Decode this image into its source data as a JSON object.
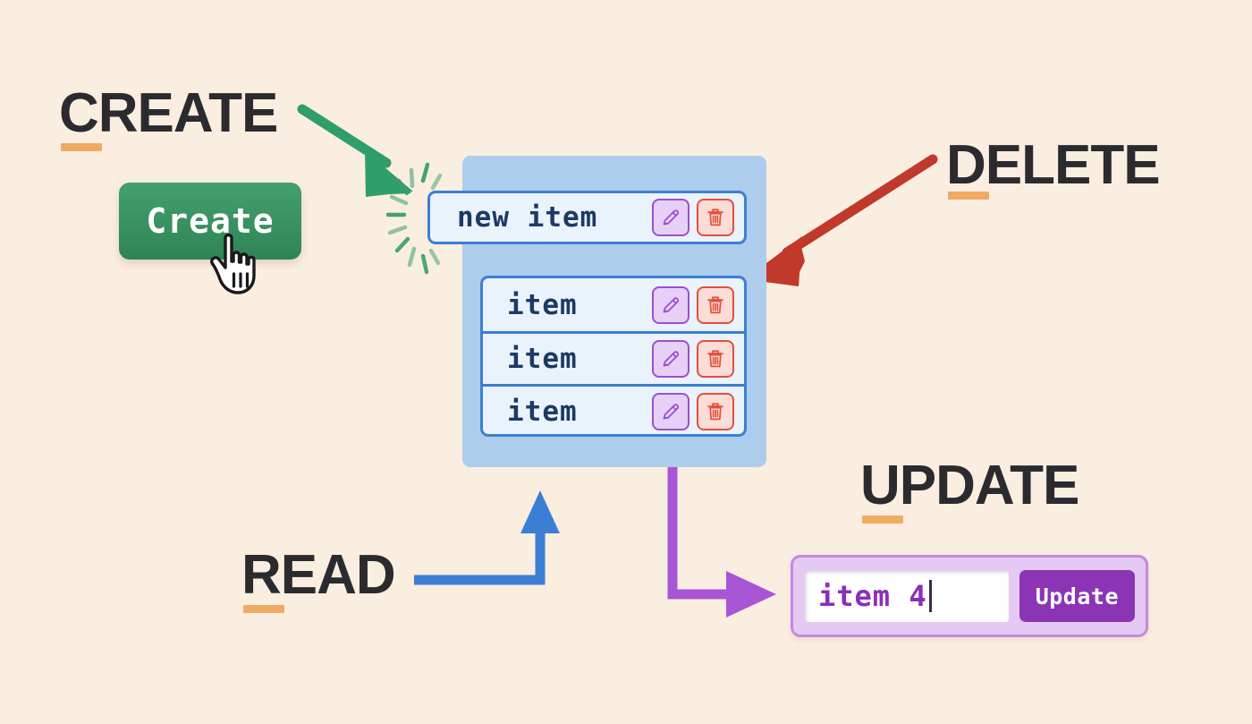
{
  "theme": {
    "background": "#faeee1",
    "label_color": "#2b2b2f",
    "underline_color": "#f0ab62",
    "create_green": "#2f8456",
    "delete_red": "#c0392b",
    "read_blue": "#3b7fd4",
    "update_purple": "#a855d6",
    "panel_blue": "#aecdec",
    "row_blue": "#eaf2fb",
    "row_text": "#1c3a63"
  },
  "labels": {
    "create": "CREATE",
    "read": "READ",
    "update": "UPDATE",
    "delete": "DELETE"
  },
  "create": {
    "button_label": "Create",
    "cursor": "pointing-hand-cursor"
  },
  "list": {
    "new_row": {
      "text": "new item",
      "edit_icon": "pencil-icon",
      "delete_icon": "trash-icon"
    },
    "rows": [
      {
        "text": "item",
        "edit_icon": "pencil-icon",
        "delete_icon": "trash-icon"
      },
      {
        "text": "item",
        "edit_icon": "pencil-icon",
        "delete_icon": "trash-icon"
      },
      {
        "text": "item",
        "edit_icon": "pencil-icon",
        "delete_icon": "trash-icon"
      }
    ]
  },
  "update_form": {
    "input_value": "item 4",
    "button_label": "Update"
  },
  "arrows": [
    {
      "name": "create-arrow",
      "color": "#2f9e68",
      "from": "CREATE",
      "to": "new item row"
    },
    {
      "name": "delete-arrow",
      "color": "#c0392b",
      "from": "DELETE",
      "to": "item trash button"
    },
    {
      "name": "read-arrow",
      "color": "#3b7fd4",
      "from": "READ",
      "to": "list panel"
    },
    {
      "name": "update-arrow",
      "color": "#a855d6",
      "from": "item pencil button",
      "to": "update input"
    }
  ]
}
